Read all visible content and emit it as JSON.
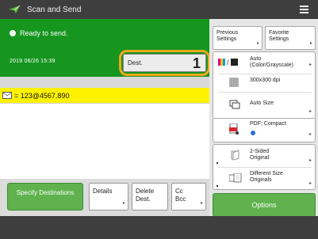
{
  "titlebar": {
    "title": "Scan and Send",
    "icon": "scan-send-arrow-icon",
    "menu_icon": "hamburger-menu-icon"
  },
  "status": {
    "ready_text": "Ready to send.",
    "datetime": "2019 06/26 15:39"
  },
  "dest": {
    "label": "Dest.",
    "count": "1"
  },
  "destination_list": [
    {
      "address": "= 123@4567.890"
    }
  ],
  "bottom_buttons": {
    "specify": "Specify Destinations",
    "details": "Details",
    "delete": "Delete Dest.",
    "cc_bcc": "Cc Bcc"
  },
  "right_panel": {
    "previous_settings": "Previous Settings",
    "favorite_settings": "Favorite Settings",
    "color_mode": "Auto (Color/Grayscale)",
    "resolution": "300x300 dpi",
    "scan_size": "Auto Size",
    "file_format": "PDF; Compact",
    "sided": "2-Sided Original",
    "diff_size": "Different Size Originals",
    "options": "Options"
  },
  "colors": {
    "header": "#3e3e3e",
    "status_green": "#16951f",
    "button_green": "#5fb24e",
    "highlight_yellow": "#fff200",
    "focus_orange": "#f2a81c"
  }
}
